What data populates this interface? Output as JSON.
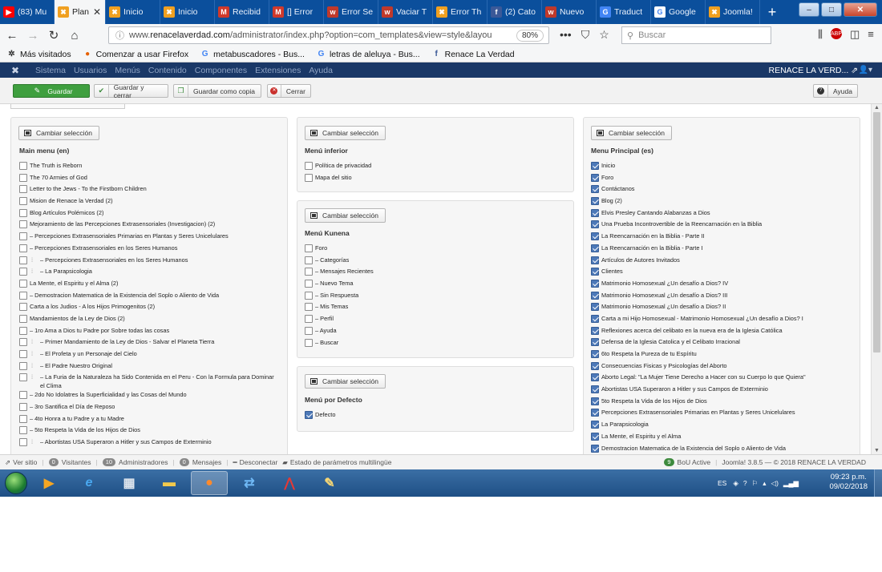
{
  "browser": {
    "tabs": [
      {
        "title": "(83) Mu",
        "favcolor": "#ff0000",
        "glyph": "▶",
        "active": false
      },
      {
        "title": "Plan",
        "favcolor": "#f0a020",
        "glyph": "✖",
        "active": true
      },
      {
        "title": "Inicio",
        "favcolor": "#f0a020",
        "glyph": "✖",
        "active": false
      },
      {
        "title": "Inicio",
        "favcolor": "#f0a020",
        "glyph": "✖",
        "active": false
      },
      {
        "title": "Recibid",
        "favcolor": "#d0392b",
        "glyph": "M",
        "active": false
      },
      {
        "title": "[] Error",
        "favcolor": "#d0392b",
        "glyph": "M",
        "active": false
      },
      {
        "title": "Error Se",
        "favcolor": "#c0392b",
        "glyph": "w",
        "active": false
      },
      {
        "title": "Vaciar T",
        "favcolor": "#c0392b",
        "glyph": "w",
        "active": false
      },
      {
        "title": "Error Th",
        "favcolor": "#f0a020",
        "glyph": "✖",
        "active": false
      },
      {
        "title": "(2) Cato",
        "favcolor": "#3b5998",
        "glyph": "f",
        "active": false
      },
      {
        "title": "Nuevo",
        "favcolor": "#c0392b",
        "glyph": "w",
        "active": false
      },
      {
        "title": "Traduct",
        "favcolor": "#4285f4",
        "glyph": "G",
        "active": false
      },
      {
        "title": "Google",
        "favcolor": "#ffffff",
        "glyph": "G",
        "active": false
      },
      {
        "title": "Joomla!",
        "favcolor": "#f0a020",
        "glyph": "✖",
        "active": false
      }
    ],
    "tab_close": "✕",
    "new_tab": "+",
    "win_min": "–",
    "win_max": "□",
    "win_close": "✕",
    "url_prefix": "www.",
    "url_host": "renacelaverdad.com",
    "url_rest": "/administrator/index.php?option=com_templates&view=style&layou",
    "zoom": "80%",
    "search_placeholder": "Buscar",
    "bookmarks": [
      {
        "label": "Más visitados",
        "glyph": "✲",
        "color": "#333"
      },
      {
        "label": "Comenzar a usar Firefox",
        "glyph": "●",
        "color": "#e66000"
      },
      {
        "label": "metabuscadores - Bus...",
        "glyph": "G",
        "color": "#4285f4"
      },
      {
        "label": "letras de aleluya - Bus...",
        "glyph": "G",
        "color": "#4285f4"
      },
      {
        "label": "Renace La Verdad",
        "glyph": "f",
        "color": "#3b5998"
      }
    ]
  },
  "joomla": {
    "menu": [
      "Sistema",
      "Usuarios",
      "Menús",
      "Contenido",
      "Componentes",
      "Extensiones",
      "Ayuda"
    ],
    "site_name": "RENACE LA VERD...",
    "toolbar": {
      "save": "Guardar",
      "save_close": "Guardar y cerrar",
      "save_copy": "Guardar como copia",
      "close": "Cerrar",
      "help": "Ayuda"
    },
    "change_selection": "Cambiar selección",
    "menus": {
      "main_en": {
        "title": "Main menu (en)",
        "items": [
          {
            "label": "The Truth is Reborn",
            "checked": false
          },
          {
            "label": "The 70 Armies of God",
            "checked": false
          },
          {
            "label": "Letter to the Jews - To the Firstborn Children",
            "checked": false
          },
          {
            "label": "Mision de Renace la Verdad (2)",
            "checked": false
          },
          {
            "label": "Blog Artículos Polémicos (2)",
            "checked": false
          },
          {
            "label": "Mejoramiento de las Percepciones Extrasensoriales (Investigacion) (2)",
            "checked": false
          },
          {
            "label": "– Percepciones Extrasensoriales Primarias en Plantas y Seres Unicelulares",
            "checked": false
          },
          {
            "label": "– Percepciones Extrasensoriales en los Seres Humanos",
            "checked": false
          },
          {
            "label": "– Percepciones Extrasensoriales en los Seres Humanos",
            "checked": false,
            "indent": true
          },
          {
            "label": "– La Parapsicologia",
            "checked": false,
            "indent": true
          },
          {
            "label": "La Mente, el Espiritu y el Alma (2)",
            "checked": false
          },
          {
            "label": "– Demostracion Matematica de la Existencia del Soplo o Aliento de Vida",
            "checked": false
          },
          {
            "label": "Carta a los Judios - A los Hijos Primogenitos (2)",
            "checked": false
          },
          {
            "label": "Mandamientos de la Ley de Dios (2)",
            "checked": false
          },
          {
            "label": "– 1ro Ama a Dios tu Padre por Sobre todas las cosas",
            "checked": false
          },
          {
            "label": "– Primer Mandamiento de la Ley de Dios - Salvar el Planeta Tierra",
            "checked": false,
            "indent": true
          },
          {
            "label": "– El Profeta y un Personaje del Cielo",
            "checked": false,
            "indent": true
          },
          {
            "label": "– El Padre Nuestro Original",
            "checked": false,
            "indent": true
          },
          {
            "label": "– La Furia de la Naturaleza ha Sido Contenida en el Peru - Con la Formula para Dominar el Clima",
            "checked": false,
            "indent": true
          },
          {
            "label": "– 2do No Idolatres la Superficialidad y las Cosas del Mundo",
            "checked": false
          },
          {
            "label": "– 3ro Santifica el Día de Reposo",
            "checked": false
          },
          {
            "label": "– 4to Honra a tu Padre y a tu Madre",
            "checked": false
          },
          {
            "label": "– 5to Respeta la Vida de los Hijos de Dios",
            "checked": false
          },
          {
            "label": "– Abortistas USA Superaron a Hitler y sus Campos de Exterminio",
            "checked": false,
            "indent": true
          }
        ]
      },
      "inferior": {
        "title": "Menú inferior",
        "items": [
          {
            "label": "Política de privacidad",
            "checked": false
          },
          {
            "label": "Mapa del sitio",
            "checked": false
          }
        ]
      },
      "kunena": {
        "title": "Menú Kunena",
        "items": [
          {
            "label": "Foro",
            "checked": false
          },
          {
            "label": "– Categorías",
            "checked": false
          },
          {
            "label": "– Mensajes Recientes",
            "checked": false
          },
          {
            "label": "– Nuevo Tema",
            "checked": false
          },
          {
            "label": "– Sin Respuesta",
            "checked": false
          },
          {
            "label": "– Mis Temas",
            "checked": false
          },
          {
            "label": "– Perfil",
            "checked": false
          },
          {
            "label": "– Ayuda",
            "checked": false
          },
          {
            "label": "– Buscar",
            "checked": false
          }
        ]
      },
      "defecto": {
        "title": "Menú por Defecto",
        "items": [
          {
            "label": "Defecto",
            "checked": true
          }
        ]
      },
      "principal": {
        "title": "Menu Principal (es)",
        "items": [
          {
            "label": "Inicio",
            "checked": true
          },
          {
            "label": "Foro",
            "checked": true
          },
          {
            "label": "Contáctanos",
            "checked": true
          },
          {
            "label": "Blog (2)",
            "checked": true
          },
          {
            "label": "Elvis Presley Cantando Alabanzas a Dios",
            "checked": true
          },
          {
            "label": "Una Prueba Incontrovertible de la Reencarnación en la Biblia",
            "checked": true
          },
          {
            "label": "La Reencarnación en la Biblia - Parte II",
            "checked": true
          },
          {
            "label": "La Reencarnación en la Biblia - Parte I",
            "checked": true
          },
          {
            "label": "Artículos de Autores Invitados",
            "checked": true
          },
          {
            "label": "Clientes",
            "checked": true
          },
          {
            "label": "Matrimonio Homosexual ¿Un desafío a Dios? IV",
            "checked": true
          },
          {
            "label": "Matrimonio Homosexual ¿Un desafío a Dios? III",
            "checked": true
          },
          {
            "label": "Matrimonio Homosexual ¿Un desafío a Dios? II",
            "checked": true
          },
          {
            "label": "Carta a mi Hijo Homosexual - Matrimonio Homosexual ¿Un desafío a Dios? I",
            "checked": true
          },
          {
            "label": "Reflexiones acerca del celibato en la nueva era de la Iglesia Católica",
            "checked": true
          },
          {
            "label": "Defensa de la Iglesia Catolica y el Celibato Irracional",
            "checked": true
          },
          {
            "label": "6to Respeta la Pureza de tu Espíritu",
            "checked": true
          },
          {
            "label": "Consecuencias Fisicas y Psicologías del Aborto",
            "checked": true
          },
          {
            "label": "Aborto Legal: \"La Mujer Tiene Derecho a Hacer con su Cuerpo lo que Quiera\"",
            "checked": true
          },
          {
            "label": "Abortistas USA Superaron a Hitler y sus Campos de Exterminio",
            "checked": true
          },
          {
            "label": "5to Respeta la Vida de los Hijos de Dios",
            "checked": true
          },
          {
            "label": "Percepciones Extrasensoriales Primarias en Plantas y Seres Unicelulares",
            "checked": true
          },
          {
            "label": "La Parapsicologia",
            "checked": true
          },
          {
            "label": "La Mente, el Espiritu y el Alma",
            "checked": true
          },
          {
            "label": "Demostracion Matematica de la Existencia del Soplo o Aliento de Vida",
            "checked": true
          }
        ]
      }
    },
    "status": {
      "view_site": "Ver sitio",
      "visitors_count": "0",
      "visitors": "Visitantes",
      "admins_count": "10",
      "admins": "Administradores",
      "messages_count": "0",
      "messages": "Mensajes",
      "logout": "Desconectar",
      "multilang": "Estado de parámetros multilingüe",
      "bou_count": "9",
      "bou": "BoU Active",
      "footer": "Joomla! 3.8.5 — © 2018 RENACE LA VERDAD"
    }
  },
  "taskbar": {
    "lang": "ES",
    "time": "09:23 p.m.",
    "date": "09/02/2018"
  }
}
